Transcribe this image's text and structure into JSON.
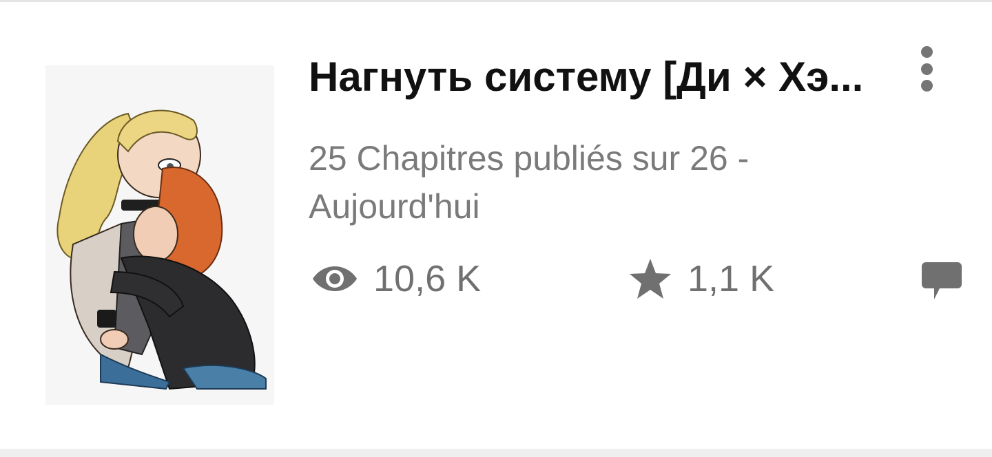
{
  "story": {
    "title": "Нагнуть систему [Ди × Хэ...",
    "chapters_line": "25 Chapitres publiés sur 26 -",
    "updated": "Aujourd'hui",
    "views": "10,6 K",
    "votes": "1,1 K"
  },
  "icons": {
    "views": "eye-icon",
    "votes": "star-icon",
    "comments": "comment-icon",
    "menu": "more-vertical-icon"
  },
  "colors": {
    "title": "#111111",
    "secondary_text": "#7a7a7a",
    "icon": "#707070"
  }
}
